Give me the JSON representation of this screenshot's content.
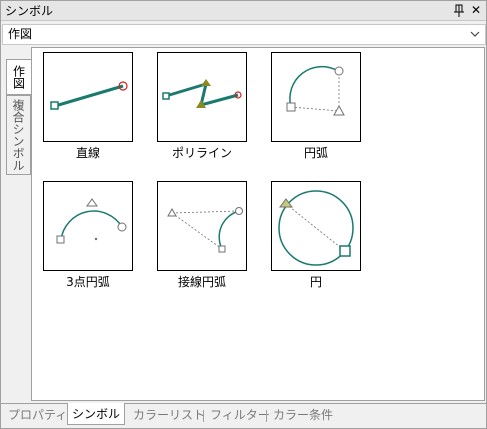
{
  "window": {
    "title": "シンボル",
    "pin_icon": "pin-icon",
    "close_icon": "close-icon",
    "close_glyph": "✕"
  },
  "category_select": {
    "value": "作図"
  },
  "side_tabs": [
    {
      "label": "作図",
      "active": true
    },
    {
      "label": "複合シンボル",
      "active": false
    }
  ],
  "symbols": [
    {
      "label": "直線",
      "icon": "line-icon"
    },
    {
      "label": "ポリライン",
      "icon": "polyline-icon"
    },
    {
      "label": "円弧",
      "icon": "arc-icon"
    },
    {
      "label": "3点円弧",
      "icon": "three-point-arc-icon"
    },
    {
      "label": "接線円弧",
      "icon": "tangent-arc-icon"
    },
    {
      "label": "円",
      "icon": "circle-icon"
    }
  ],
  "bottom_tabs": [
    {
      "label": "プロパティ",
      "active": false
    },
    {
      "label": "シンボル",
      "active": true
    },
    {
      "label": "カラーリスト",
      "active": false
    },
    {
      "label": "フィルター",
      "active": false
    },
    {
      "label": "カラー条件",
      "active": false
    }
  ],
  "colors": {
    "stroke_green": "#1a7a6e",
    "handle_red": "#d02020",
    "handle_gray": "#707070",
    "handle_olive": "#8a8a20"
  }
}
